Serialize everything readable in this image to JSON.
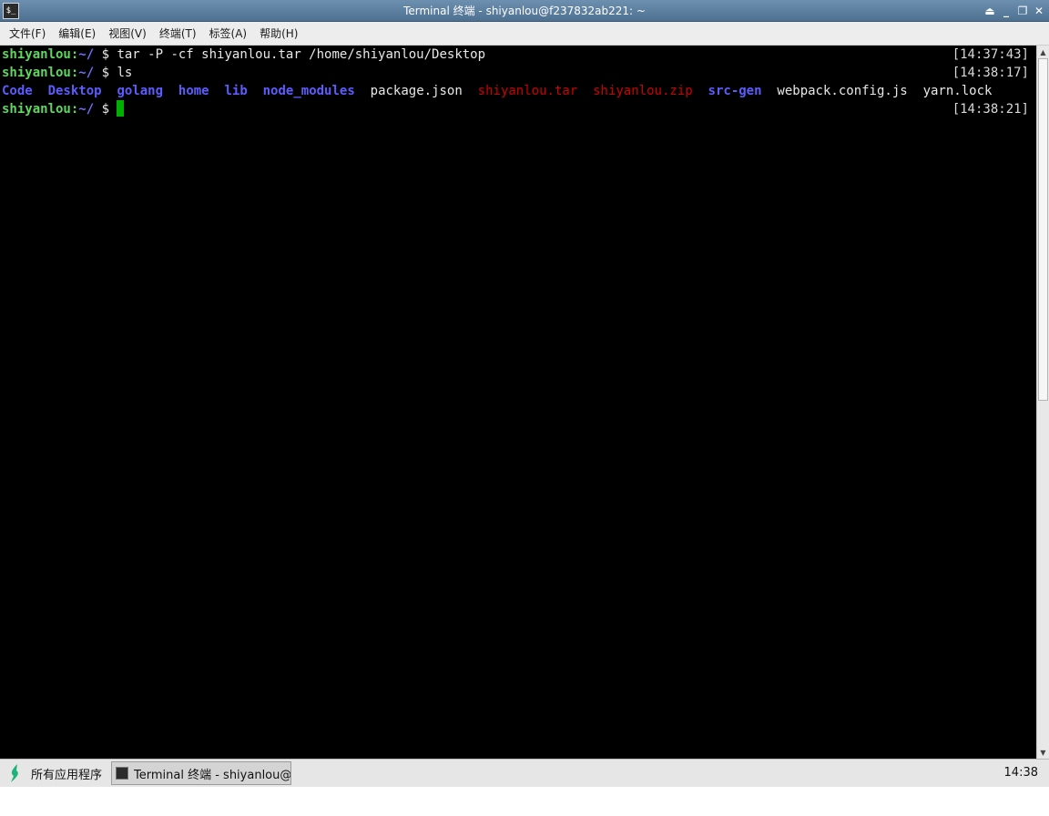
{
  "window": {
    "title": "Terminal 终端 - shiyanlou@f237832ab221: ~",
    "icon": "terminal-icon",
    "controls": [
      "shade-icon",
      "minimize-icon",
      "maximize-icon",
      "close-icon"
    ]
  },
  "menubar": {
    "items": [
      "文件(F)",
      "编辑(E)",
      "视图(V)",
      "终端(T)",
      "标签(A)",
      "帮助(H)"
    ]
  },
  "terminal": {
    "prompt_user": "shiyanlou:",
    "prompt_path": "~/",
    "prompt_symbol": " $ ",
    "lines": [
      {
        "command": "tar -P -cf shiyanlou.tar /home/shiyanlou/Desktop",
        "timestamp": "[14:37:43]"
      },
      {
        "command": "ls",
        "timestamp": "[14:38:17]"
      },
      {
        "command": "",
        "timestamp": "[14:38:21]"
      }
    ],
    "ls_output": [
      {
        "name": "Code",
        "kind": "dir"
      },
      {
        "name": "Desktop",
        "kind": "dir"
      },
      {
        "name": "golang",
        "kind": "dir"
      },
      {
        "name": "home",
        "kind": "dir"
      },
      {
        "name": "lib",
        "kind": "dir"
      },
      {
        "name": "node_modules",
        "kind": "dir"
      },
      {
        "name": "package.json",
        "kind": "file"
      },
      {
        "name": "shiyanlou.tar",
        "kind": "archive"
      },
      {
        "name": "shiyanlou.zip",
        "kind": "archive"
      },
      {
        "name": "src-gen",
        "kind": "dir"
      },
      {
        "name": "webpack.config.js",
        "kind": "file"
      },
      {
        "name": "yarn.lock",
        "kind": "file"
      }
    ],
    "colors": {
      "user": "#5fd75f",
      "dir": "#5c5cff",
      "archive": "#cd0000",
      "cursor": "#00b000"
    }
  },
  "taskbar": {
    "start_label": "所有应用程序",
    "start_icon": "shiyanlou-logo-icon",
    "task_label": "Terminal 终端 - shiyanlou@f…",
    "clock": "14:38"
  }
}
